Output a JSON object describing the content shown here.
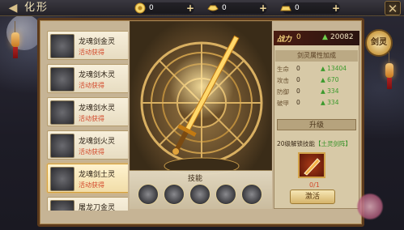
{
  "header": {
    "title": "化形",
    "currencies": [
      {
        "icon": "coin-icon",
        "value": "0"
      },
      {
        "icon": "ingot-icon",
        "value": "0"
      },
      {
        "icon": "gold-bar-icon",
        "value": "0"
      }
    ]
  },
  "spirit_list": [
    {
      "name": "龙魂剑金灵",
      "status": "活动获得",
      "selected": false
    },
    {
      "name": "龙魂剑木灵",
      "status": "活动获得",
      "selected": false
    },
    {
      "name": "龙魂剑水灵",
      "status": "活动获得",
      "selected": false
    },
    {
      "name": "龙魂剑火灵",
      "status": "活动获得",
      "selected": false
    },
    {
      "name": "龙魂剑土灵",
      "status": "活动获得",
      "selected": true
    },
    {
      "name": "屠龙刀金灵",
      "status": "",
      "selected": false
    }
  ],
  "skills": {
    "title": "技能",
    "icons": [
      "skill-1-icon",
      "skill-2-icon",
      "skill-3-icon",
      "skill-4-icon",
      "skill-5-icon"
    ]
  },
  "right_panel": {
    "power_label": "战力",
    "power_value": "0",
    "power_total": "20082",
    "attr_header": "剑灵属性加成",
    "stats": [
      {
        "name": "生命",
        "value": "0",
        "add": "13404"
      },
      {
        "name": "攻击",
        "value": "0",
        "add": "670"
      },
      {
        "name": "防御",
        "value": "0",
        "add": "334"
      },
      {
        "name": "破甲",
        "value": "0",
        "add": "334"
      }
    ],
    "upgrade_label": "升级",
    "unlock_text": "20级解锁技能",
    "unlock_skill": "【土灵剑阵】",
    "unlock_count": "0/1",
    "activate_label": "激活"
  },
  "side_tab": {
    "label": "剑灵"
  }
}
